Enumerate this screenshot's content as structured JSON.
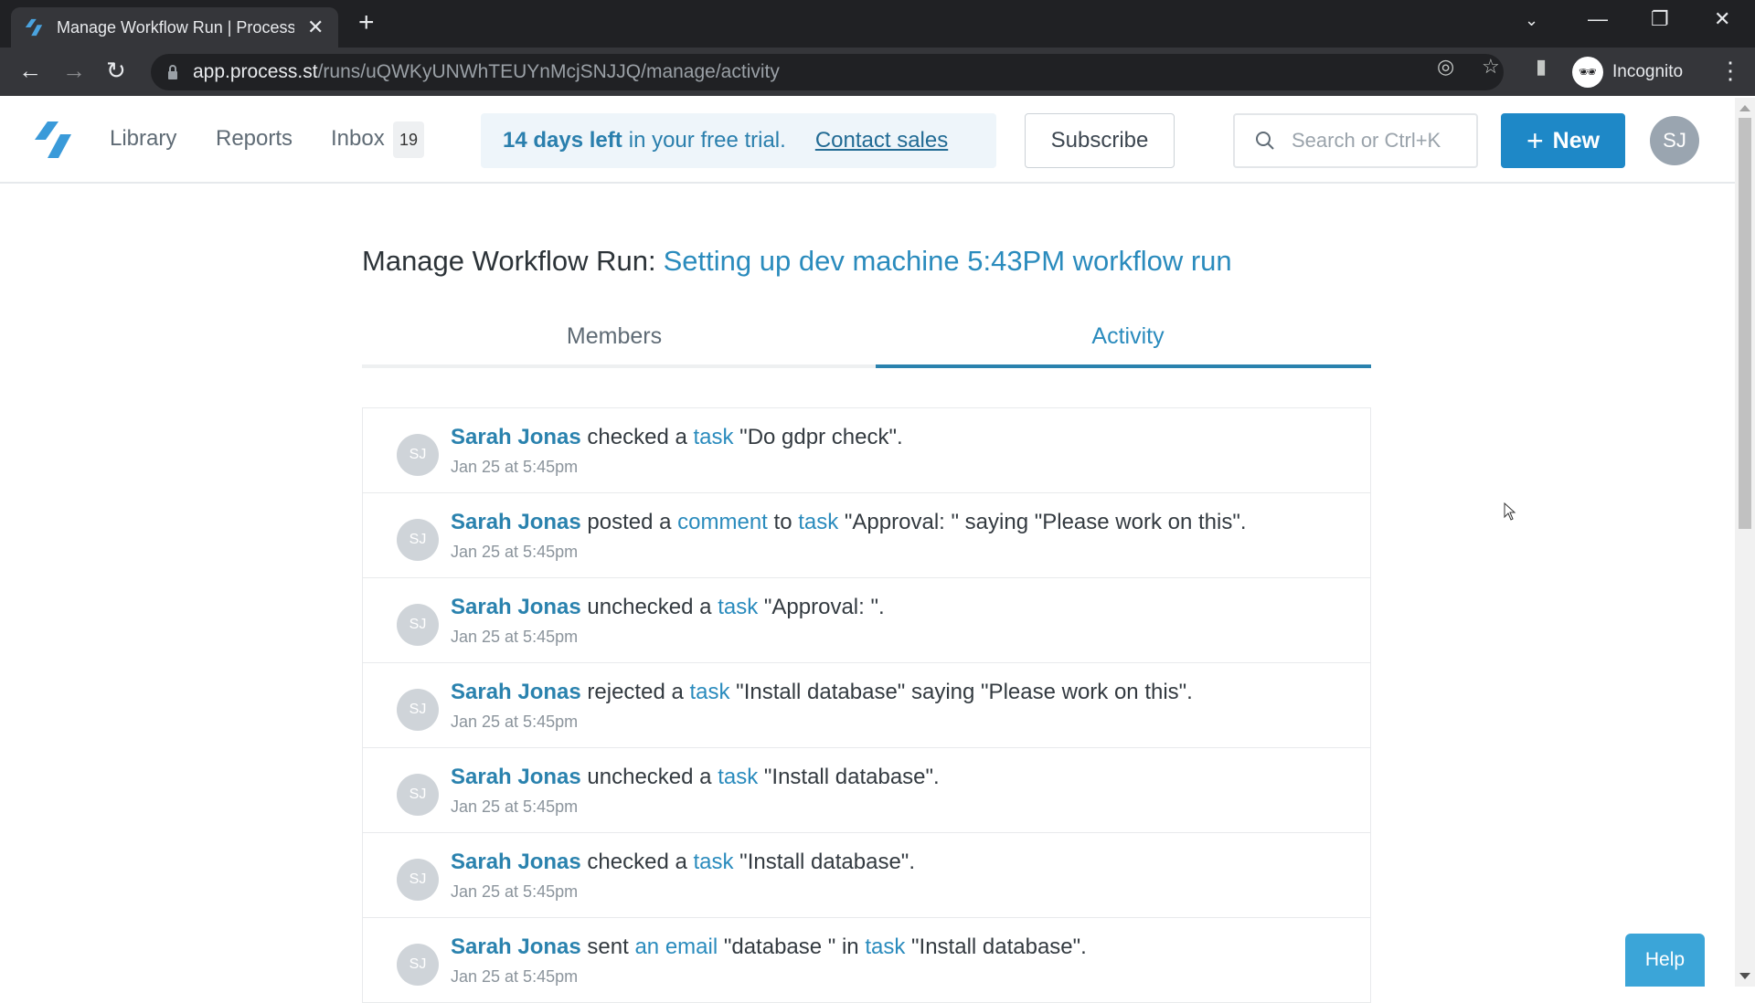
{
  "browser": {
    "tab_title": "Manage Workflow Run | Process",
    "url_host": "app.process.st",
    "url_path": "/runs/uQWKyUNWhTEUYnMcjSNJJQ/manage/activity",
    "profile_label": "Incognito"
  },
  "header": {
    "nav": {
      "library": "Library",
      "reports": "Reports",
      "inbox": "Inbox",
      "inbox_count": "19"
    },
    "trial": {
      "days_left": "14 days left",
      "rest": "in your free trial.",
      "contact_sales": "Contact sales"
    },
    "subscribe_label": "Subscribe",
    "search_placeholder": "Search or Ctrl+K",
    "new_label": "New",
    "user_initials": "SJ"
  },
  "page": {
    "title_prefix": "Manage Workflow Run:",
    "run_name": "Setting up dev machine 5:43PM workflow run",
    "tabs": [
      {
        "label": "Members",
        "active": false
      },
      {
        "label": "Activity",
        "active": true
      }
    ]
  },
  "colors": {
    "accent": "#2a8bbd",
    "primary_button": "#1e88c7",
    "help_button": "#3ba5d8"
  },
  "activity": [
    {
      "initials": "SJ",
      "user": "Sarah Jonas",
      "parts": [
        [
          "t",
          "checked a"
        ],
        [
          "l",
          "task"
        ],
        [
          "t",
          "\"Do gdpr check\"."
        ]
      ],
      "time": "Jan 25 at 5:45pm"
    },
    {
      "initials": "SJ",
      "user": "Sarah Jonas",
      "parts": [
        [
          "t",
          "posted a"
        ],
        [
          "l",
          "comment"
        ],
        [
          "t",
          "to"
        ],
        [
          "l",
          "task"
        ],
        [
          "t",
          "\"Approval: \" saying \"Please work on this\"."
        ]
      ],
      "time": "Jan 25 at 5:45pm"
    },
    {
      "initials": "SJ",
      "user": "Sarah Jonas",
      "parts": [
        [
          "t",
          "unchecked a"
        ],
        [
          "l",
          "task"
        ],
        [
          "t",
          "\"Approval: \"."
        ]
      ],
      "time": "Jan 25 at 5:45pm"
    },
    {
      "initials": "SJ",
      "user": "Sarah Jonas",
      "parts": [
        [
          "t",
          "rejected a"
        ],
        [
          "l",
          "task"
        ],
        [
          "t",
          "\"Install database\" saying \"Please work on this\"."
        ]
      ],
      "time": "Jan 25 at 5:45pm"
    },
    {
      "initials": "SJ",
      "user": "Sarah Jonas",
      "parts": [
        [
          "t",
          "unchecked a"
        ],
        [
          "l",
          "task"
        ],
        [
          "t",
          "\"Install database\"."
        ]
      ],
      "time": "Jan 25 at 5:45pm"
    },
    {
      "initials": "SJ",
      "user": "Sarah Jonas",
      "parts": [
        [
          "t",
          "checked a"
        ],
        [
          "l",
          "task"
        ],
        [
          "t",
          "\"Install database\"."
        ]
      ],
      "time": "Jan 25 at 5:45pm"
    },
    {
      "initials": "SJ",
      "user": "Sarah Jonas",
      "parts": [
        [
          "t",
          "sent"
        ],
        [
          "l",
          "an email"
        ],
        [
          "t",
          "\"database \" in"
        ],
        [
          "l",
          "task"
        ],
        [
          "t",
          "\"Install database\"."
        ]
      ],
      "time": "Jan 25 at 5:45pm"
    }
  ],
  "help_label": "Help"
}
